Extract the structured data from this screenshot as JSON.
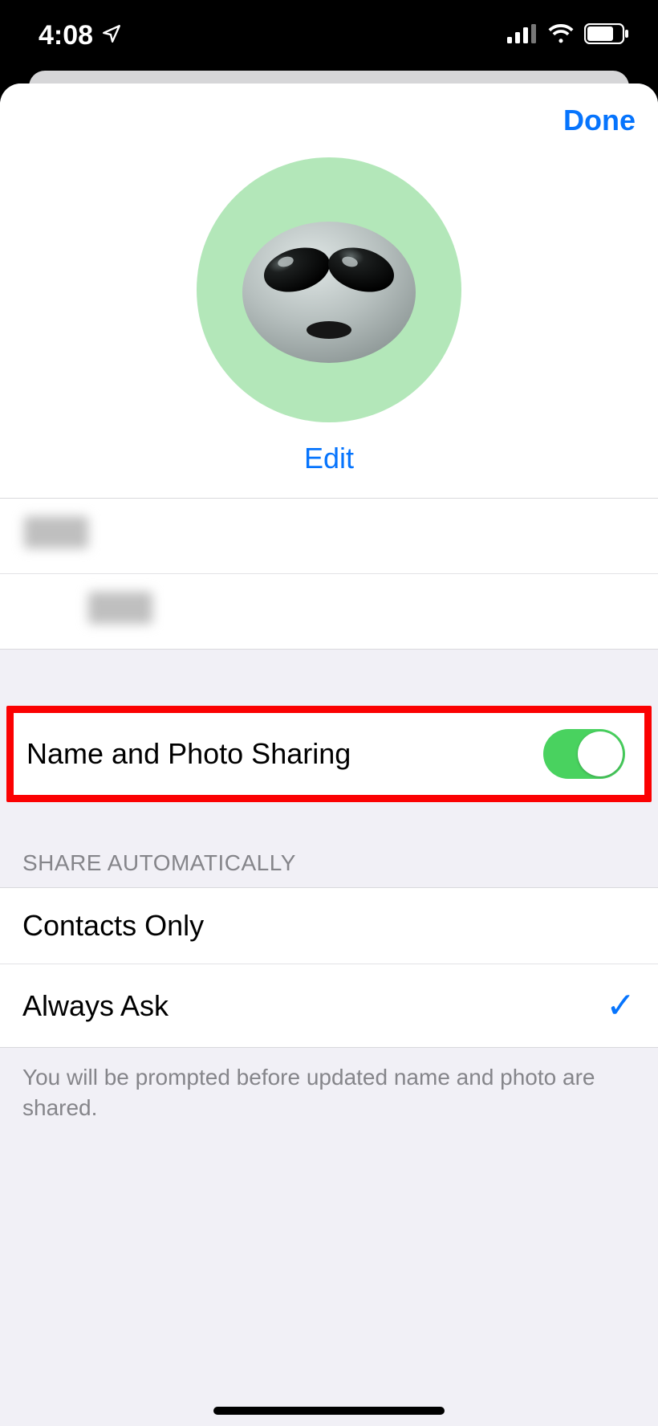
{
  "status_bar": {
    "time": "4:08",
    "location_icon": "location-arrow",
    "signal_icon": "cellular-signal",
    "wifi_icon": "wifi",
    "battery_icon": "battery"
  },
  "sheet": {
    "done_label": "Done",
    "avatar": {
      "bg_color": "#b3e7b9",
      "memoji": "alien"
    },
    "edit_label": "Edit",
    "name_fields": {
      "first": "",
      "last": ""
    },
    "sharing_toggle": {
      "label": "Name and Photo Sharing",
      "on": true,
      "highlighted": true
    },
    "share_auto": {
      "header": "SHARE AUTOMATICALLY",
      "options": [
        {
          "label": "Contacts Only",
          "selected": false
        },
        {
          "label": "Always Ask",
          "selected": true
        }
      ],
      "footer": "You will be prompted before updated name and photo are shared."
    }
  }
}
